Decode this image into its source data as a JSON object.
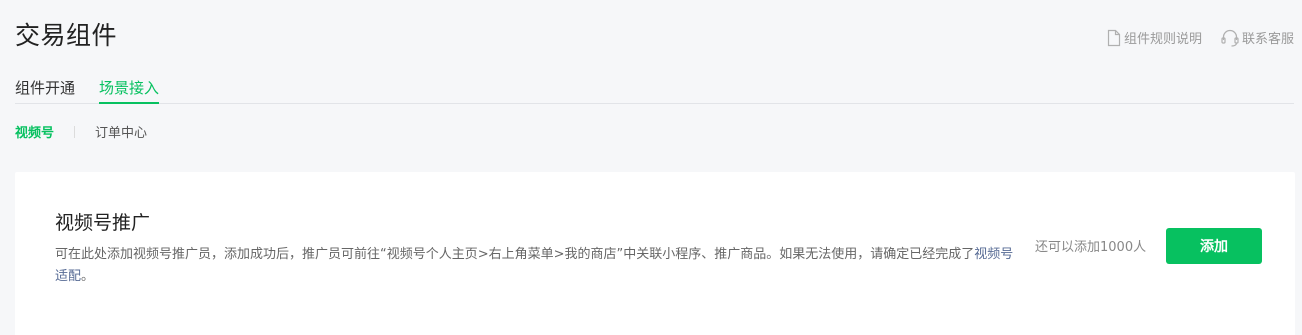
{
  "page": {
    "title": "交易组件"
  },
  "top_links": {
    "rules": {
      "label": "组件规则说明",
      "icon": "document-icon"
    },
    "support": {
      "label": "联系客服",
      "icon": "headset-icon"
    }
  },
  "tabs": [
    {
      "label": "组件开通",
      "active": false
    },
    {
      "label": "场景接入",
      "active": true
    }
  ],
  "subtabs": [
    {
      "label": "视频号",
      "active": true
    },
    {
      "label": "订单中心",
      "active": false
    }
  ],
  "card": {
    "title": "视频号推广",
    "desc_text": "可在此处添加视频号推广员，添加成功后，推广员可前往“视频号个人主页>右上角菜单>我的商店”中关联小程序、推广商品。如果无法使用，请确定已经完成了",
    "desc_link": "视频号适配",
    "desc_end": "。",
    "quota": "还可以添加1000人",
    "add_label": "添加"
  },
  "colors": {
    "accent": "#07c160",
    "link": "#576b95"
  }
}
